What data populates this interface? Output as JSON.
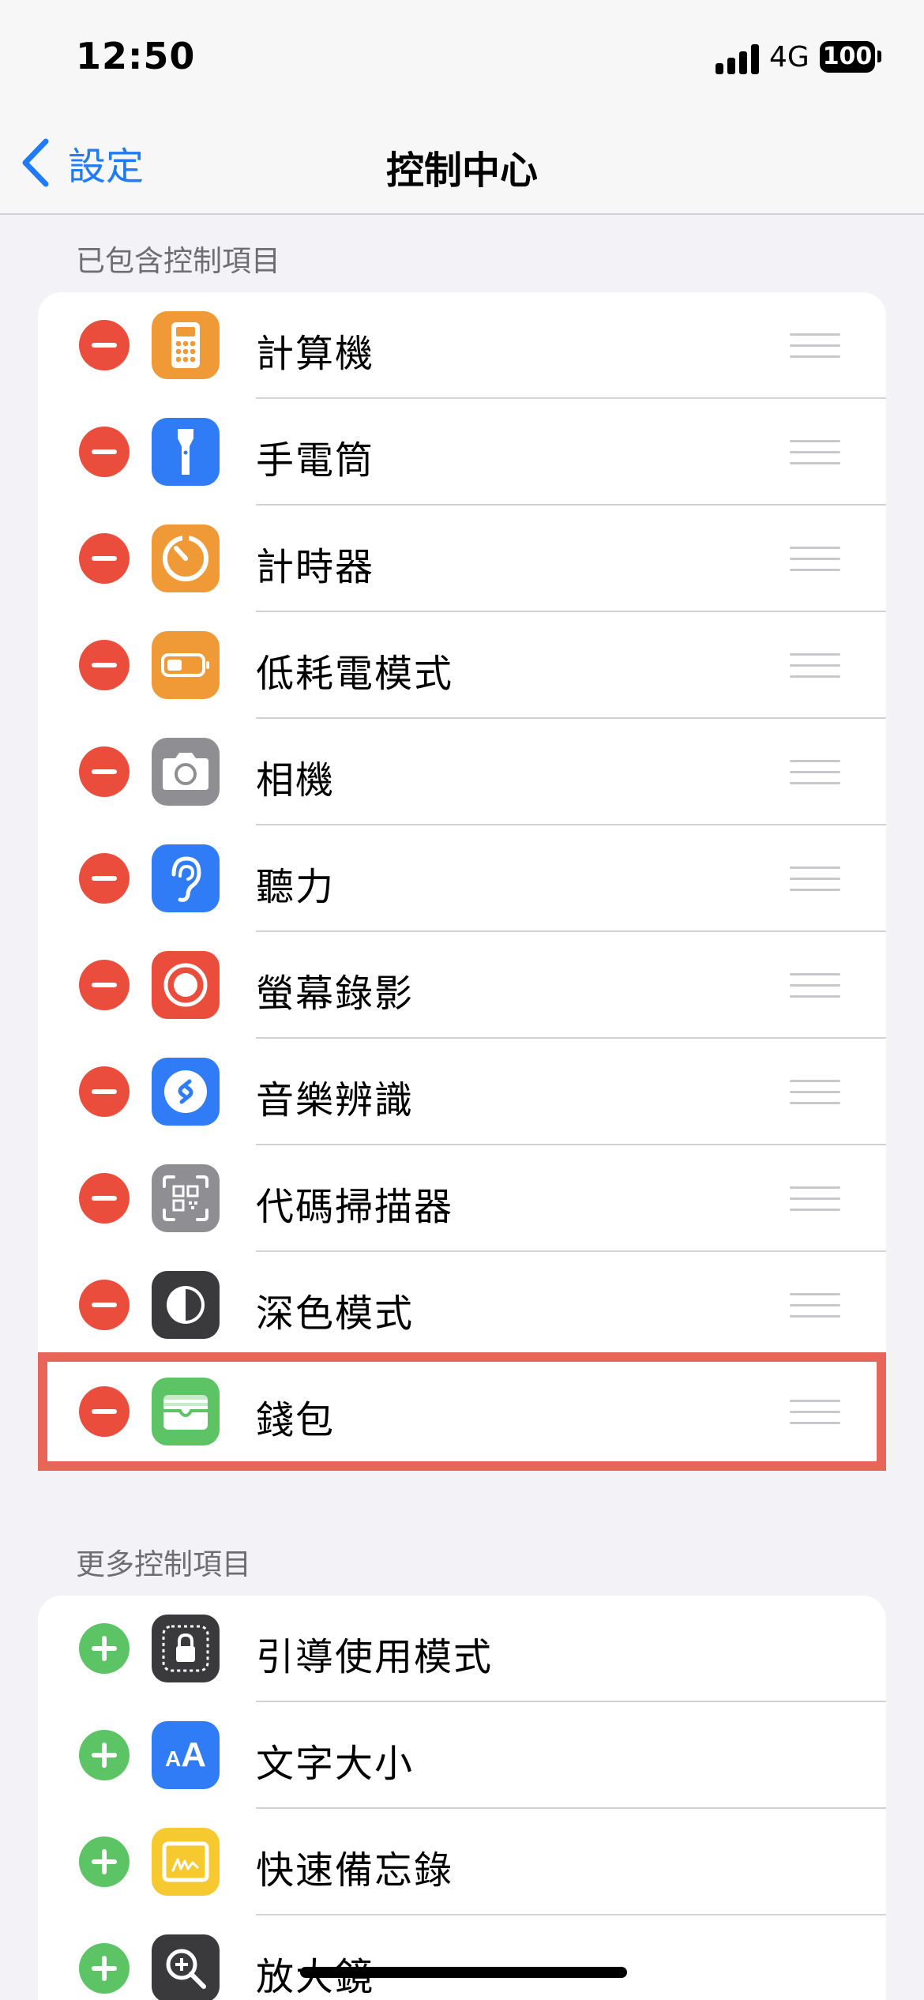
{
  "status_bar": {
    "time": "12:50",
    "network": "4G",
    "battery": "100"
  },
  "nav": {
    "back_label": "設定",
    "title": "控制中心"
  },
  "included": {
    "header": "已包含控制項目",
    "items": [
      {
        "label": "計算機",
        "icon": "calculator-icon",
        "color": "#f09a37"
      },
      {
        "label": "手電筒",
        "icon": "flashlight-icon",
        "color": "#2f7cf6"
      },
      {
        "label": "計時器",
        "icon": "timer-icon",
        "color": "#f09a37"
      },
      {
        "label": "低耗電模式",
        "icon": "battery-icon",
        "color": "#f09a37"
      },
      {
        "label": "相機",
        "icon": "camera-icon",
        "color": "#8e8e93"
      },
      {
        "label": "聽力",
        "icon": "ear-icon",
        "color": "#2f7cf6"
      },
      {
        "label": "螢幕錄影",
        "icon": "record-icon",
        "color": "#eb4d3d"
      },
      {
        "label": "音樂辨識",
        "icon": "shazam-icon",
        "color": "#2f7cf6"
      },
      {
        "label": "代碼掃描器",
        "icon": "qr-scanner-icon",
        "color": "#8e8e93"
      },
      {
        "label": "深色模式",
        "icon": "dark-mode-icon",
        "color": "#3a3a3c"
      },
      {
        "label": "錢包",
        "icon": "wallet-icon",
        "color": "#5dc466"
      }
    ]
  },
  "more": {
    "header": "更多控制項目",
    "items": [
      {
        "label": "引導使用模式",
        "icon": "guided-access-icon",
        "color": "#3a3a3c"
      },
      {
        "label": "文字大小",
        "icon": "text-size-icon",
        "color": "#2f7cf6"
      },
      {
        "label": "快速備忘錄",
        "icon": "quick-note-icon",
        "color": "#f5c92f"
      },
      {
        "label": "放大鏡",
        "icon": "magnifier-icon",
        "color": "#3a3a3c"
      }
    ]
  },
  "text_size_glyph": "AA"
}
